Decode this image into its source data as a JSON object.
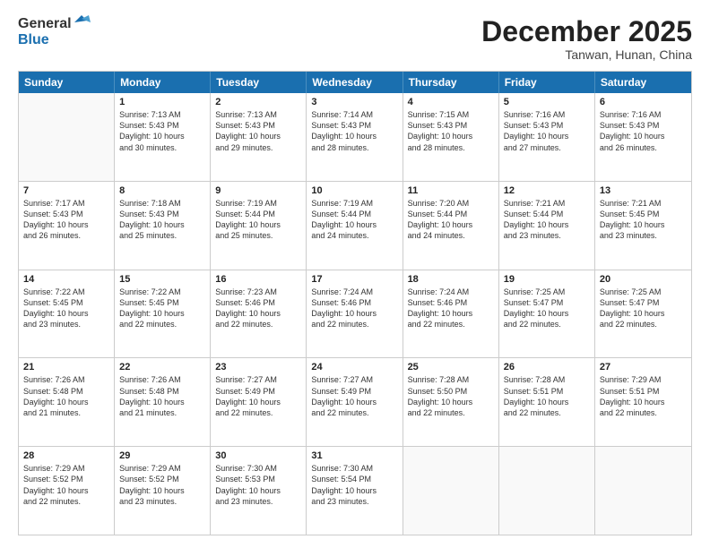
{
  "logo": {
    "line1": "General",
    "line2": "Blue",
    "icon_color": "#1a6faf"
  },
  "header": {
    "month": "December 2025",
    "location": "Tanwan, Hunan, China"
  },
  "days": [
    "Sunday",
    "Monday",
    "Tuesday",
    "Wednesday",
    "Thursday",
    "Friday",
    "Saturday"
  ],
  "weeks": [
    [
      {
        "day": "",
        "text": ""
      },
      {
        "day": "1",
        "text": "Sunrise: 7:13 AM\nSunset: 5:43 PM\nDaylight: 10 hours\nand 30 minutes."
      },
      {
        "day": "2",
        "text": "Sunrise: 7:13 AM\nSunset: 5:43 PM\nDaylight: 10 hours\nand 29 minutes."
      },
      {
        "day": "3",
        "text": "Sunrise: 7:14 AM\nSunset: 5:43 PM\nDaylight: 10 hours\nand 28 minutes."
      },
      {
        "day": "4",
        "text": "Sunrise: 7:15 AM\nSunset: 5:43 PM\nDaylight: 10 hours\nand 28 minutes."
      },
      {
        "day": "5",
        "text": "Sunrise: 7:16 AM\nSunset: 5:43 PM\nDaylight: 10 hours\nand 27 minutes."
      },
      {
        "day": "6",
        "text": "Sunrise: 7:16 AM\nSunset: 5:43 PM\nDaylight: 10 hours\nand 26 minutes."
      }
    ],
    [
      {
        "day": "7",
        "text": "Sunrise: 7:17 AM\nSunset: 5:43 PM\nDaylight: 10 hours\nand 26 minutes."
      },
      {
        "day": "8",
        "text": "Sunrise: 7:18 AM\nSunset: 5:43 PM\nDaylight: 10 hours\nand 25 minutes."
      },
      {
        "day": "9",
        "text": "Sunrise: 7:19 AM\nSunset: 5:44 PM\nDaylight: 10 hours\nand 25 minutes."
      },
      {
        "day": "10",
        "text": "Sunrise: 7:19 AM\nSunset: 5:44 PM\nDaylight: 10 hours\nand 24 minutes."
      },
      {
        "day": "11",
        "text": "Sunrise: 7:20 AM\nSunset: 5:44 PM\nDaylight: 10 hours\nand 24 minutes."
      },
      {
        "day": "12",
        "text": "Sunrise: 7:21 AM\nSunset: 5:44 PM\nDaylight: 10 hours\nand 23 minutes."
      },
      {
        "day": "13",
        "text": "Sunrise: 7:21 AM\nSunset: 5:45 PM\nDaylight: 10 hours\nand 23 minutes."
      }
    ],
    [
      {
        "day": "14",
        "text": "Sunrise: 7:22 AM\nSunset: 5:45 PM\nDaylight: 10 hours\nand 23 minutes."
      },
      {
        "day": "15",
        "text": "Sunrise: 7:22 AM\nSunset: 5:45 PM\nDaylight: 10 hours\nand 22 minutes."
      },
      {
        "day": "16",
        "text": "Sunrise: 7:23 AM\nSunset: 5:46 PM\nDaylight: 10 hours\nand 22 minutes."
      },
      {
        "day": "17",
        "text": "Sunrise: 7:24 AM\nSunset: 5:46 PM\nDaylight: 10 hours\nand 22 minutes."
      },
      {
        "day": "18",
        "text": "Sunrise: 7:24 AM\nSunset: 5:46 PM\nDaylight: 10 hours\nand 22 minutes."
      },
      {
        "day": "19",
        "text": "Sunrise: 7:25 AM\nSunset: 5:47 PM\nDaylight: 10 hours\nand 22 minutes."
      },
      {
        "day": "20",
        "text": "Sunrise: 7:25 AM\nSunset: 5:47 PM\nDaylight: 10 hours\nand 22 minutes."
      }
    ],
    [
      {
        "day": "21",
        "text": "Sunrise: 7:26 AM\nSunset: 5:48 PM\nDaylight: 10 hours\nand 21 minutes."
      },
      {
        "day": "22",
        "text": "Sunrise: 7:26 AM\nSunset: 5:48 PM\nDaylight: 10 hours\nand 21 minutes."
      },
      {
        "day": "23",
        "text": "Sunrise: 7:27 AM\nSunset: 5:49 PM\nDaylight: 10 hours\nand 22 minutes."
      },
      {
        "day": "24",
        "text": "Sunrise: 7:27 AM\nSunset: 5:49 PM\nDaylight: 10 hours\nand 22 minutes."
      },
      {
        "day": "25",
        "text": "Sunrise: 7:28 AM\nSunset: 5:50 PM\nDaylight: 10 hours\nand 22 minutes."
      },
      {
        "day": "26",
        "text": "Sunrise: 7:28 AM\nSunset: 5:51 PM\nDaylight: 10 hours\nand 22 minutes."
      },
      {
        "day": "27",
        "text": "Sunrise: 7:29 AM\nSunset: 5:51 PM\nDaylight: 10 hours\nand 22 minutes."
      }
    ],
    [
      {
        "day": "28",
        "text": "Sunrise: 7:29 AM\nSunset: 5:52 PM\nDaylight: 10 hours\nand 22 minutes."
      },
      {
        "day": "29",
        "text": "Sunrise: 7:29 AM\nSunset: 5:52 PM\nDaylight: 10 hours\nand 23 minutes."
      },
      {
        "day": "30",
        "text": "Sunrise: 7:30 AM\nSunset: 5:53 PM\nDaylight: 10 hours\nand 23 minutes."
      },
      {
        "day": "31",
        "text": "Sunrise: 7:30 AM\nSunset: 5:54 PM\nDaylight: 10 hours\nand 23 minutes."
      },
      {
        "day": "",
        "text": ""
      },
      {
        "day": "",
        "text": ""
      },
      {
        "day": "",
        "text": ""
      }
    ]
  ]
}
